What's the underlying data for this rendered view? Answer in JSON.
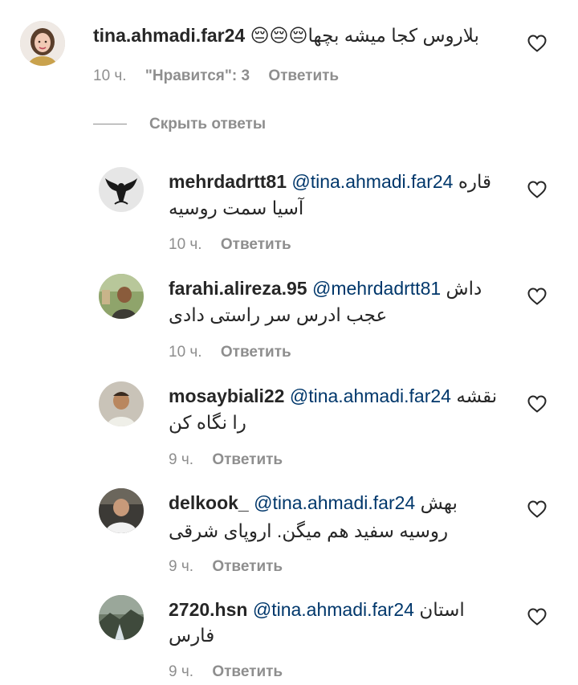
{
  "root_comment": {
    "username": "tina.ahmadi.far24",
    "text": "بلاروس کجا میشه بچها😔😔😔",
    "time": "10 ч.",
    "likes": "\"Нравится\": 3",
    "reply": "Ответить"
  },
  "hide_replies_label": "Скрыть ответы",
  "replies": [
    {
      "username": "mehrdadrtt81",
      "mention": "@tina.ahmadi.far24",
      "text_line1": "قاره",
      "text_line2": "آسیا سمت روسیه",
      "time": "10 ч.",
      "reply": "Ответить"
    },
    {
      "username": "farahi.alireza.95",
      "mention": "@mehrdadrtt81",
      "text_line1": "داش",
      "text_line2": "عجب ادرس سر راستی دادی",
      "time": "10 ч.",
      "reply": "Ответить"
    },
    {
      "username": "mosaybiali22",
      "mention": "@tina.ahmadi.far24",
      "text_line1": "نقشه",
      "text_line2": "را نگاه کن",
      "time": "9 ч.",
      "reply": "Ответить"
    },
    {
      "username": "delkook_",
      "mention": "@tina.ahmadi.far24",
      "text_line1": "بهش",
      "text_line2": "روسیه سفید هم میگن. اروپای شرقی",
      "time": "9 ч.",
      "reply": "Ответить"
    },
    {
      "username": "2720.hsn",
      "mention": "@tina.ahmadi.far24",
      "text_line1": "استان",
      "text_line2": "فارس",
      "time": "9 ч.",
      "reply": "Ответить"
    }
  ],
  "colors": {
    "text": "#262626",
    "secondary": "#8e8e8e",
    "mention": "#00376b",
    "background": "#ffffff"
  },
  "icons": {
    "like": "heart-outline-icon"
  }
}
